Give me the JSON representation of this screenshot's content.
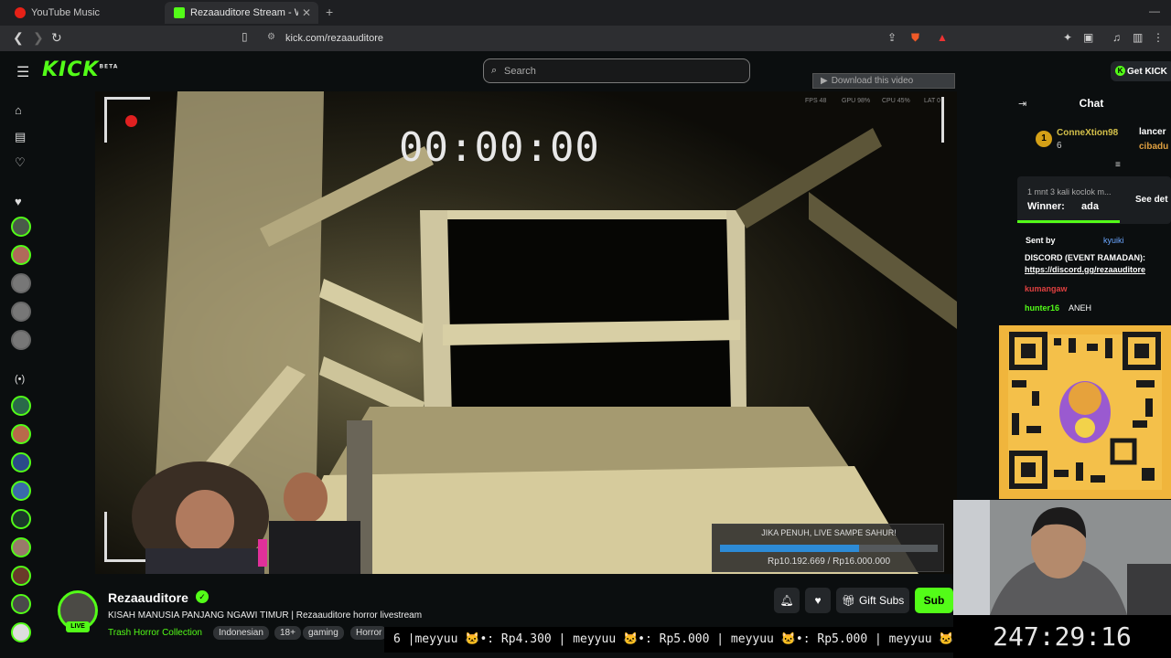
{
  "browser": {
    "tabs": [
      {
        "title": "YouTube Music"
      },
      {
        "title": "Rezaauditore Stream - Watch"
      }
    ],
    "url": "kick.com/rezaauditore"
  },
  "header": {
    "logo": "KICK",
    "logo_sup": "BETA",
    "search_placeholder": "Search",
    "download_label": "Download this video",
    "get_kick": "Get KICK"
  },
  "video": {
    "timer": "00:00:00",
    "hud": [
      "FPS 48",
      "GPU 98%",
      "CPU 45%",
      "LAT 0"
    ],
    "goal": {
      "title": "JIKA PENUH, LIVE SAMPE SAHUR!",
      "amount": "Rp10.192.669 / Rp16.000.000",
      "progress": 0.637
    }
  },
  "channel": {
    "name": "Rezaauditore",
    "live": "LIVE",
    "stream_title": "KISAH MANUSIA PANJANG NGAWI TIMUR | Rezaauditore horror livestream",
    "category": "Trash Horror Collection",
    "tags": [
      "Indonesian",
      "18+",
      "gaming",
      "Horror"
    ],
    "gift_subs": "Gift Subs",
    "subscribe": "Sub"
  },
  "ticker": "6 |meyyuu 🐱•: Rp4.300 | meyyuu 🐱•: Rp5.000 | meyyuu 🐱•: Rp5.000 | meyyuu 🐱",
  "chat": {
    "title": "Chat",
    "gifter_rank": "1",
    "gifter_name": "ConneXtion98",
    "gifter_count": "6",
    "gifter2": "lancer",
    "gifter3": "cibadu",
    "poll_question": "1 mnt 3 kali koclok m...",
    "poll_winner_label": "Winner:",
    "poll_winner": "ada",
    "see_details": "See det",
    "sent_by": "Sent by",
    "sent_user": "kyuiki",
    "discord_label": "DISCORD (EVENT RAMADAN):",
    "discord_link": "https://discord.gg/rezaauditore",
    "messages": [
      {
        "user": "kumangaw",
        "text": ""
      },
      {
        "user": "hunter16",
        "text": "ANEH"
      }
    ]
  },
  "stream_clock": "247:29:16",
  "colors": {
    "accent": "#53fc18",
    "bg": "#0b0e0f"
  }
}
